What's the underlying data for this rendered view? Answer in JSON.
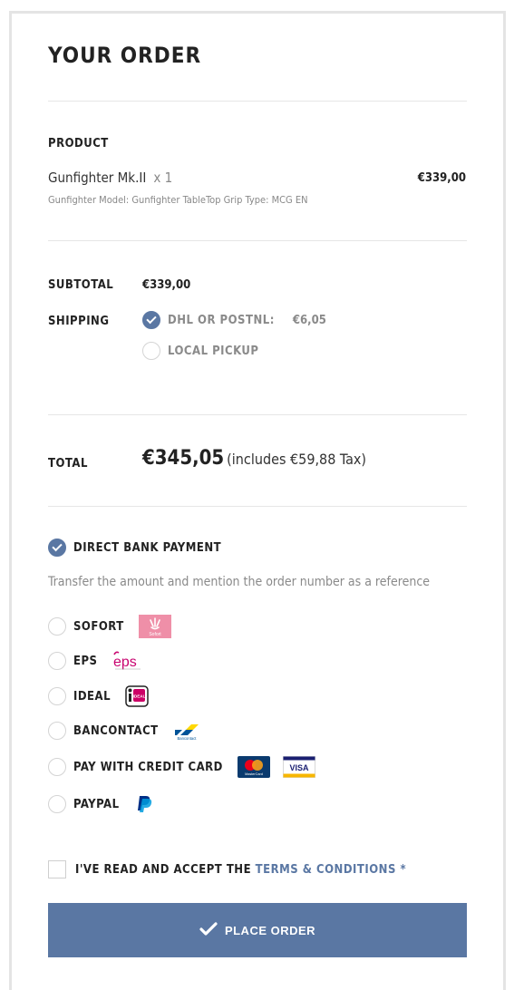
{
  "order": {
    "title": "YOUR ORDER",
    "product_header": "PRODUCT",
    "product": {
      "name": "Gunfighter Mk.II",
      "qty": "x 1",
      "price": "€339,00",
      "meta": "Gunfighter Model: Gunfighter TableTop Grip Type: MCG EN"
    },
    "subtotal": {
      "label": "SUBTOTAL",
      "value": "€339,00"
    },
    "shipping": {
      "label": "SHIPPING",
      "options": [
        {
          "label": "DHL OR POSTNL:",
          "price": "€6,05",
          "selected": true
        },
        {
          "label": "LOCAL PICKUP",
          "price": "",
          "selected": false
        }
      ]
    },
    "total": {
      "label": "TOTAL",
      "value": "€345,05",
      "tax": "(includes €59,88 Tax)"
    }
  },
  "payment": {
    "methods": [
      {
        "label": "DIRECT BANK PAYMENT",
        "selected": true,
        "logo": ""
      },
      {
        "label": "SOFORT",
        "selected": false,
        "logo": "sofort-logo"
      },
      {
        "label": "EPS",
        "selected": false,
        "logo": "eps-logo"
      },
      {
        "label": "IDEAL",
        "selected": false,
        "logo": "ideal-logo"
      },
      {
        "label": "BANCONTACT",
        "selected": false,
        "logo": "bancontact-logo"
      },
      {
        "label": "PAY WITH CREDIT CARD",
        "selected": false,
        "logo": "mastercard-visa-logos"
      },
      {
        "label": "PAYPAL",
        "selected": false,
        "logo": "paypal-logo"
      }
    ],
    "direct_bank_description": "Transfer the amount and mention the order number as a reference",
    "logo_text": {
      "sofort": "Sofort",
      "eps": "eps",
      "ideal": "iDEAL",
      "bancontact": "Bancontact",
      "mastercard": "MasterCard",
      "visa": "VISA"
    }
  },
  "terms": {
    "text": "I'VE READ AND ACCEPT THE",
    "link": "TERMS & CONDITIONS",
    "required_mark": "*",
    "checked": false
  },
  "place_order": {
    "label": "PLACE ORDER"
  },
  "colors": {
    "accent": "#5a77a3",
    "sofort_pink": "#ef8fa8",
    "eps_pink": "#c8036f",
    "bancontact_blue": "#005498",
    "bancontact_yellow": "#ffd800",
    "paypal_dark": "#003087",
    "paypal_light": "#009cde"
  }
}
